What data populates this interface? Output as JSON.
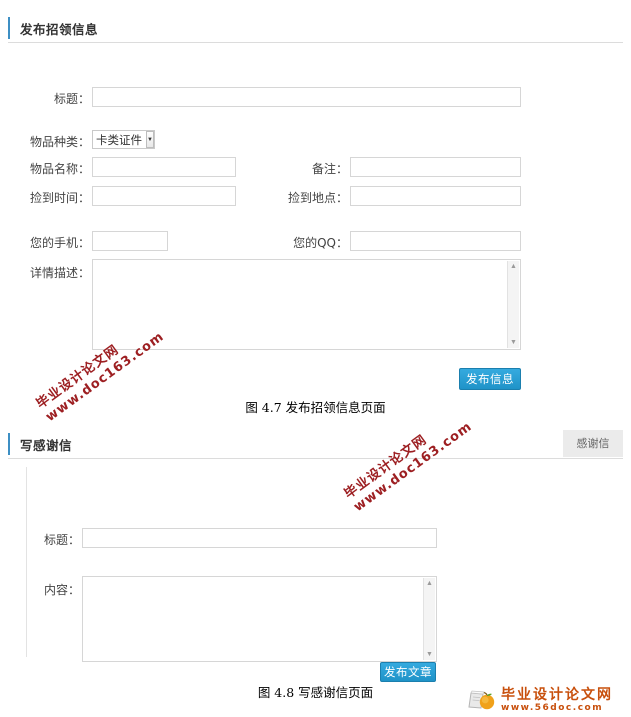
{
  "panel1": {
    "title": "发布招领信息",
    "accent_color": "#3d8fc4",
    "fields": {
      "title_label": "标题：",
      "title_value": "",
      "category_label": "物品种类：",
      "category_value": "卡类证件",
      "item_name_label": "物品名称：",
      "item_name_value": "",
      "remark_label": "备注：",
      "remark_value": "",
      "found_time_label": "捡到时间：",
      "found_time_value": "",
      "found_place_label": "捡到地点：",
      "found_place_value": "",
      "phone_label": "您的手机：",
      "phone_value": "",
      "qq_label": "您的QQ：",
      "qq_value": "",
      "detail_label": "详情描述：",
      "detail_value": ""
    },
    "submit_label": "发布信息",
    "submit_color": "#2ba3da"
  },
  "caption1": "图 4.7 发布招领信息页面",
  "panel2": {
    "title": "写感谢信",
    "tab_label": "感谢信",
    "accent_color": "#3d8fc4",
    "fields": {
      "title_label": "标题：",
      "title_value": "",
      "content_label": "内容：",
      "content_value": ""
    },
    "submit_label": "发布文章",
    "submit_color": "#2ba3da"
  },
  "caption2": "图 4.8 写感谢信页面",
  "watermark": {
    "line1": "毕业设计论文网",
    "line2": "www.doc163.com",
    "color": "#9d1f22"
  },
  "logo": {
    "cn": "毕业设计论文网",
    "en": "www.56doc.com",
    "color": "#c8500d"
  },
  "scrollbar": {
    "up_glyph": "▲",
    "down_glyph": "▼"
  },
  "select_arrow_glyph": "▼"
}
